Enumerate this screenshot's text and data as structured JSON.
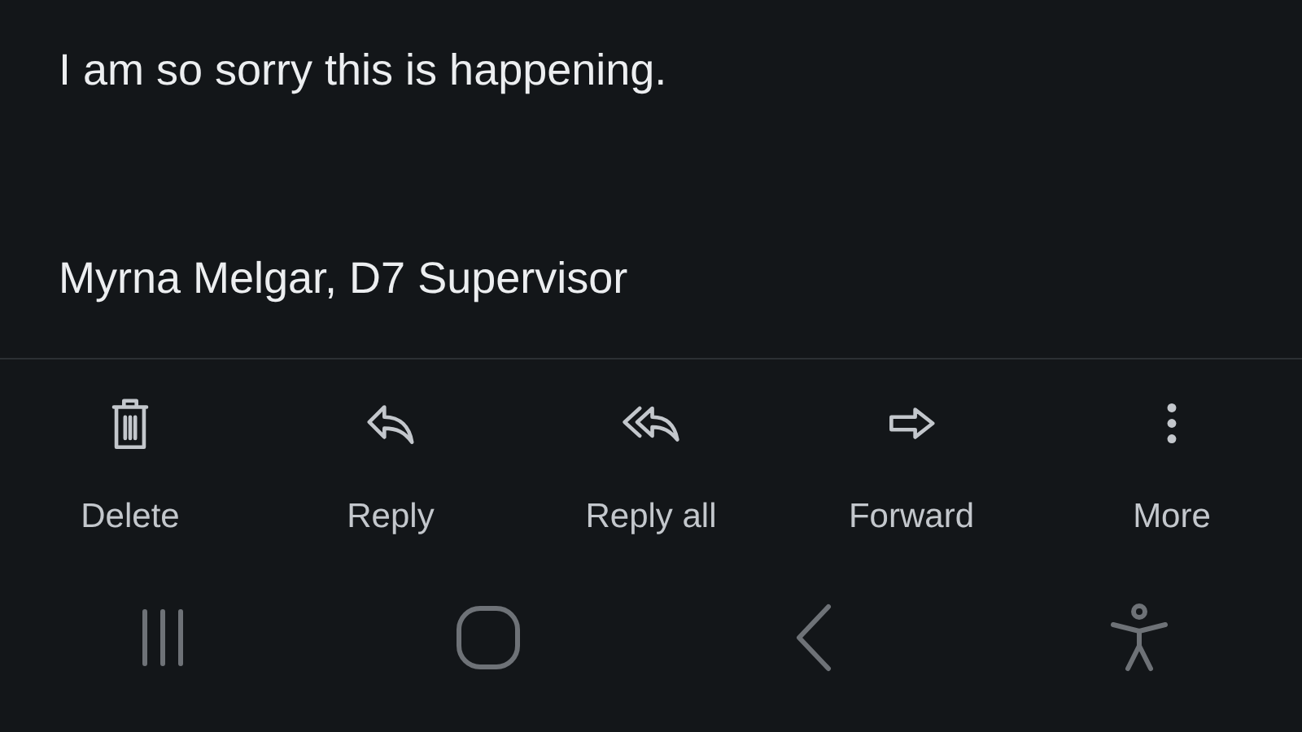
{
  "message": {
    "paragraphs": [
      "I am so sorry this is happening.",
      "Myrna Melgar, D7 Supervisor"
    ]
  },
  "actions": [
    {
      "kind": "delete",
      "label": "Delete"
    },
    {
      "kind": "reply",
      "label": "Reply"
    },
    {
      "kind": "reply_all",
      "label": "Reply all"
    },
    {
      "kind": "forward",
      "label": "Forward"
    },
    {
      "kind": "more",
      "label": "More"
    }
  ],
  "nav_bar": [
    {
      "kind": "recents"
    },
    {
      "kind": "home"
    },
    {
      "kind": "back"
    },
    {
      "kind": "accessibility"
    }
  ]
}
